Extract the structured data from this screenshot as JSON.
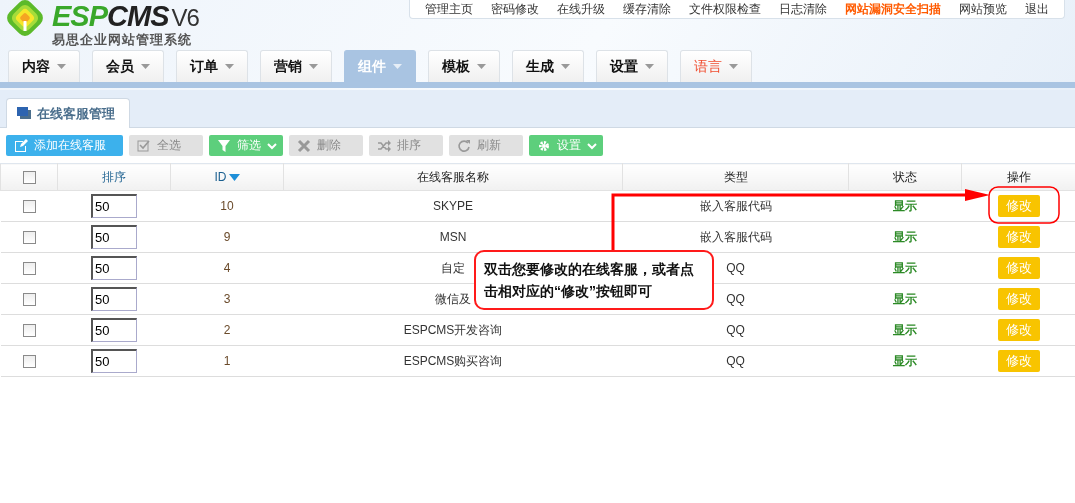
{
  "logo": {
    "brand_a": "ESP",
    "brand_b": "CMS",
    "version": "V6",
    "subtitle": "易思企业网站管理系统"
  },
  "top_links": [
    {
      "label": "管理主页",
      "highlight": false
    },
    {
      "label": "密码修改",
      "highlight": false
    },
    {
      "label": "在线升级",
      "highlight": false
    },
    {
      "label": "缓存清除",
      "highlight": false
    },
    {
      "label": "文件权限检查",
      "highlight": false
    },
    {
      "label": "日志清除",
      "highlight": false
    },
    {
      "label": "网站漏洞安全扫描",
      "highlight": true
    },
    {
      "label": "网站预览",
      "highlight": false
    },
    {
      "label": "退出",
      "highlight": false
    }
  ],
  "nav": [
    {
      "label": "内容",
      "selected": false,
      "highlight": false
    },
    {
      "label": "会员",
      "selected": false,
      "highlight": false
    },
    {
      "label": "订单",
      "selected": false,
      "highlight": false
    },
    {
      "label": "营销",
      "selected": false,
      "highlight": false
    },
    {
      "label": "组件",
      "selected": true,
      "highlight": false
    },
    {
      "label": "模板",
      "selected": false,
      "highlight": false
    },
    {
      "label": "生成",
      "selected": false,
      "highlight": false
    },
    {
      "label": "设置",
      "selected": false,
      "highlight": false
    },
    {
      "label": "语言",
      "selected": false,
      "highlight": true
    }
  ],
  "page_tab": {
    "label": "在线客服管理"
  },
  "toolbar": [
    {
      "label": "添加在线客服",
      "kind": "primary"
    },
    {
      "label": "全选",
      "kind": "plain"
    },
    {
      "label": "筛选",
      "kind": "dropdown"
    },
    {
      "label": "删除",
      "kind": "plain"
    },
    {
      "label": "排序",
      "kind": "plain"
    },
    {
      "label": "刷新",
      "kind": "plain"
    },
    {
      "label": "设置",
      "kind": "dropdown"
    }
  ],
  "table": {
    "columns": [
      {
        "label": "排序",
        "sortable": true,
        "sorted": false
      },
      {
        "label": "ID",
        "sortable": true,
        "sorted": true
      },
      {
        "label": "在线客服名称",
        "sortable": false
      },
      {
        "label": "类型",
        "sortable": false
      },
      {
        "label": "状态",
        "sortable": false
      },
      {
        "label": "操作",
        "sortable": false
      }
    ],
    "all_checked": false,
    "rows": [
      {
        "checked": false,
        "order": "50",
        "id": "10",
        "name": "SKYPE",
        "type": "嵌入客服代码",
        "status": "显示",
        "action": "修改"
      },
      {
        "checked": false,
        "order": "50",
        "id": "9",
        "name": "MSN",
        "type": "嵌入客服代码",
        "status": "显示",
        "action": "修改"
      },
      {
        "checked": false,
        "order": "50",
        "id": "4",
        "name": "自定",
        "type": "QQ",
        "status": "显示",
        "action": "修改"
      },
      {
        "checked": false,
        "order": "50",
        "id": "3",
        "name": "微信及",
        "type": "QQ",
        "status": "显示",
        "action": "修改"
      },
      {
        "checked": false,
        "order": "50",
        "id": "2",
        "name": "ESPCMS开发咨询",
        "type": "QQ",
        "status": "显示",
        "action": "修改"
      },
      {
        "checked": false,
        "order": "50",
        "id": "1",
        "name": "ESPCMS购买咨询",
        "type": "QQ",
        "status": "显示",
        "action": "修改"
      }
    ]
  },
  "callout": {
    "text": "双击您要修改的在线客服，或者点击相对应的“修改”按钮即可"
  }
}
